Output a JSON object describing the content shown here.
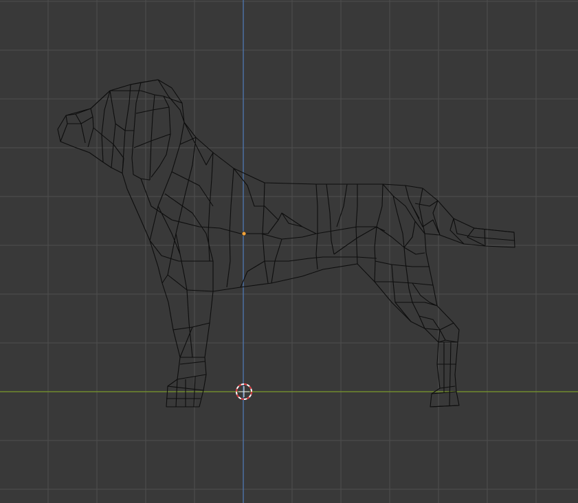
{
  "viewport": {
    "view": "side-orthographic",
    "shading": "wireframe",
    "colors": {
      "background": "#393939",
      "grid_minor": "#444444",
      "grid_major": "#4e4e4e",
      "axis_x": "#7d9b2c",
      "axis_z": "#4f78b3",
      "wire": "#0d0d0d",
      "origin": "#f2a33a",
      "cursor_red": "#d8343a",
      "cursor_white": "#ffffff"
    }
  },
  "object": {
    "name_icon": "mesh-icon",
    "subject": "dog"
  },
  "cursor": {
    "icon": "3d-cursor-icon"
  },
  "origin": {
    "icon": "object-origin-icon"
  }
}
